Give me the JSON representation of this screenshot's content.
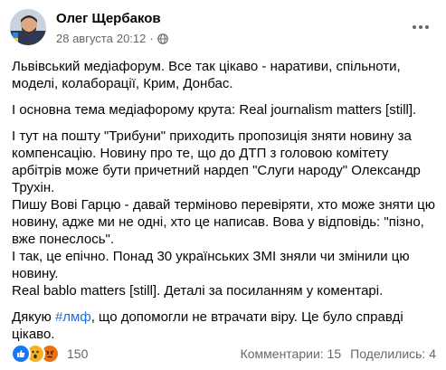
{
  "post": {
    "author": "Олег Щербаков",
    "date": "28 августа",
    "time": "20:12",
    "meta_separator": "·",
    "icons": {
      "audience": "globe-icon",
      "more": "more-options-icon"
    },
    "paragraphs": [
      "Львівський медіафорум. Все так цікаво - наративи, спільноти, моделі, колаборації, Крим, Донбас.",
      "І основна тема медіафорому крута: Real journalism matters [still].",
      "І тут на пошту \"Трибуни\" приходить пропозиція зняти новину за компенсацію. Новину про те, що до ДТП з головою комітету арбітрів може бути причетний нардеп \"Слуги народу\" Олександр Трухін.",
      "Пишу Вові Гарцю - давай терміново перевіряти, хто може зняти цю новину, адже ми не одні, хто це написав. Вова у відповідь: \"пізно, вже понеслось\".",
      "І так, це епічно. Понад 30 українських ЗМІ зняли чи змінили цю новину.",
      "Real bablo matters [still]. Деталі за посиланням у коментарі."
    ],
    "closing": {
      "before": "Дякую ",
      "hashtag": "#лмф",
      "after": ", що допомогли не втрачати віру. Це було справді цікаво."
    }
  },
  "footer": {
    "reactions": [
      "like-icon",
      "wow-icon",
      "angry-icon"
    ],
    "reaction_count": "150",
    "comments": "Комментарии: 15",
    "shares": "Поделились: 4"
  },
  "colors": {
    "text": "#050505",
    "secondary": "#65676b",
    "link": "#216fdb",
    "like": "#1877f2",
    "wow": "#f7b125",
    "angry": "#e9710f"
  }
}
